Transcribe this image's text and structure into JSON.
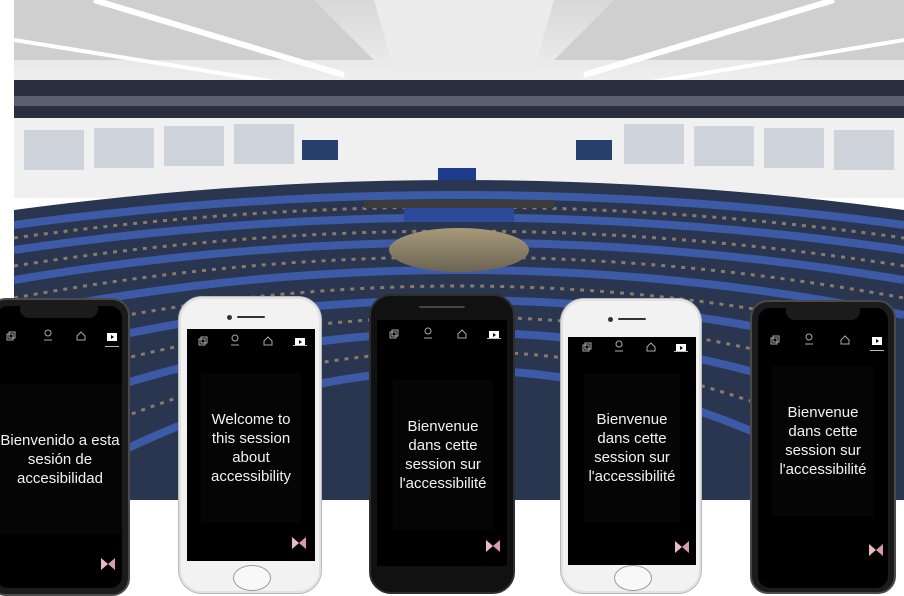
{
  "scene": {
    "background_description_colors": {
      "seats": "#2b3d72",
      "ceiling": "#e6e6e6",
      "floor": "#9a8b6a"
    }
  },
  "phones": [
    {
      "caption": "Bienvenido a esta sesión de accesibilidad"
    },
    {
      "caption": "Welcome to this session about accessibility"
    },
    {
      "caption": "Bienvenue dans cette session sur l'accessibilité"
    },
    {
      "caption": "Bienvenue dans cette session sur l'accessibilité"
    },
    {
      "caption": "Bienvenue dans cette session sur l'accessibilité"
    }
  ],
  "nav_icons": [
    "copy-icon",
    "user-icon",
    "home-icon",
    "play-icon"
  ],
  "colors": {
    "screen": "#000000",
    "text": "#f2f2f2",
    "logo": "#e9b9c6"
  }
}
